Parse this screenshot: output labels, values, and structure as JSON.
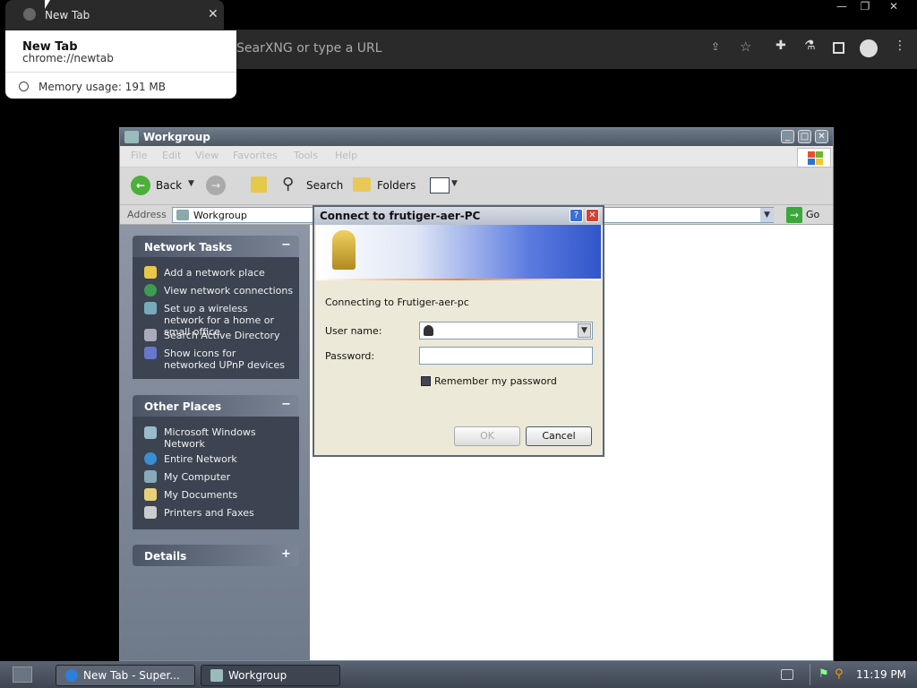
{
  "browser": {
    "tab_title": "New Tab",
    "omnibox_placeholder": "SearXNG or type a URL",
    "tooltip": {
      "title": "New Tab",
      "url": "chrome://newtab",
      "memory": "Memory usage: 191 MB"
    }
  },
  "window": {
    "title": "Workgroup",
    "menus": [
      "File",
      "Edit",
      "View",
      "Favorites",
      "Tools",
      "Help"
    ],
    "toolbar": {
      "back": "Back",
      "search": "Search",
      "folders": "Folders"
    },
    "address": {
      "label": "Address",
      "value": "Workgroup",
      "go": "Go"
    }
  },
  "sidebar": {
    "network_tasks": {
      "title": "Network Tasks",
      "items": [
        "Add a network place",
        "View network connections",
        "Set up a wireless network for a home or small office",
        "Search Active Directory",
        "Show icons for networked UPnP devices"
      ]
    },
    "other_places": {
      "title": "Other Places",
      "items": [
        "Microsoft Windows Network",
        "Entire Network",
        "My Computer",
        "My Documents",
        "Printers and Faxes"
      ]
    },
    "details": {
      "title": "Details"
    }
  },
  "dialog": {
    "title": "Connect to frutiger-aer-PC",
    "connecting": "Connecting to Frutiger-aer-pc",
    "username_label": "User name:",
    "password_label": "Password:",
    "remember": "Remember my password",
    "ok": "OK",
    "cancel": "Cancel"
  },
  "taskbar": {
    "items": [
      "New Tab - Super...",
      "Workgroup"
    ],
    "clock": "11:19 PM"
  }
}
